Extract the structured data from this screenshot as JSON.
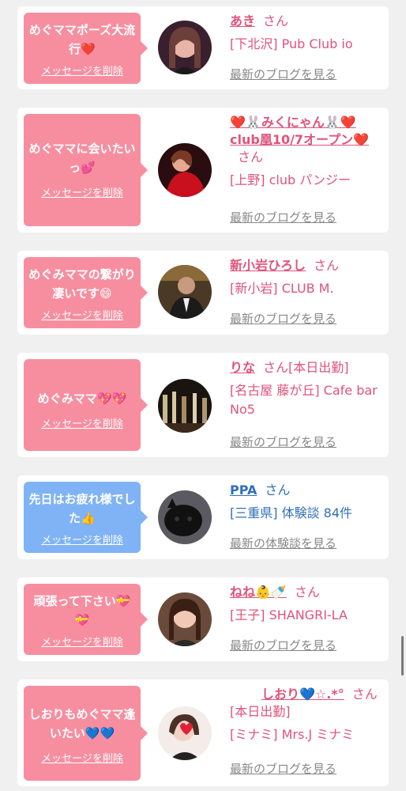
{
  "items": [
    {
      "message": "めぐママポーズ大流行❤️",
      "delete_label": "メッセージを削除",
      "name": "あき",
      "suffix": "さん",
      "shop": "[下北沢] Pub Club io",
      "link": "最新のブログを見る",
      "bubble_color": "#f78ea0"
    },
    {
      "message": "めぐママに会いたいっ💕",
      "delete_label": "メッセージを削除",
      "name": "❤️🐰みくにゃん🐰❤️club凰10/7オープン❤️",
      "suffix": "さん",
      "shop": "[上野] club パンジー",
      "link": "最新のブログを見る",
      "bubble_color": "#f78ea0"
    },
    {
      "message": "めぐみママの繋がり凄いです😄",
      "delete_label": "メッセージを削除",
      "name": "新小岩ひろし",
      "suffix": "さん",
      "shop": "[新小岩] CLUB M.",
      "link": "最新のブログを見る",
      "bubble_color": "#f78ea0"
    },
    {
      "message": "めぐみママ💖💖",
      "delete_label": "メッセージを削除",
      "name": "りな",
      "suffix": "さん[本日出勤]",
      "shop": "[名古屋 藤が丘] Cafe bar No5",
      "link": "最新のブログを見る",
      "bubble_color": "#f78ea0"
    },
    {
      "message": "先日はお疲れ様でした👍",
      "delete_label": "メッセージを削除",
      "name": "PPA",
      "suffix": "さん",
      "shop": "[三重県] 体験談 84件",
      "link": "最新の体験談を見る",
      "bubble_color": "#7fb3f5"
    },
    {
      "message": "頑張って下さい💝💝",
      "delete_label": "メッセージを削除",
      "name": "ねね👶🍼",
      "suffix": "さん",
      "shop": "[王子] SHANGRI-LA",
      "link": "最新のブログを見る",
      "bubble_color": "#f78ea0"
    },
    {
      "message": "しおりもめぐママ逢いたい💙💙",
      "delete_label": "メッセージを削除",
      "name": "しおり💙☆.*°",
      "suffix": "さん[本日出勤]",
      "shop": "[ミナミ] Mrs.J ミナミ",
      "link": "最新のブログを見る",
      "bubble_color": "#f78ea0"
    }
  ]
}
